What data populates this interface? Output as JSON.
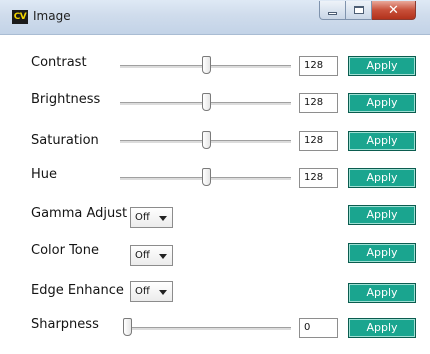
{
  "window": {
    "title": "Image",
    "icon": "CV"
  },
  "sliders": [
    {
      "label": "Contrast",
      "value": "128",
      "position": 0.5,
      "apply": "Apply"
    },
    {
      "label": "Brightness",
      "value": "128",
      "position": 0.5,
      "apply": "Apply"
    },
    {
      "label": "Saturation",
      "value": "128",
      "position": 0.5,
      "apply": "Apply"
    },
    {
      "label": "Hue",
      "value": "128",
      "position": 0.5,
      "apply": "Apply"
    }
  ],
  "dropdowns": [
    {
      "label": "Gamma Adjust",
      "selected": "Off",
      "apply": "Apply"
    },
    {
      "label": "Color Tone",
      "selected": "Off",
      "apply": "Apply"
    },
    {
      "label": "Edge Enhance",
      "selected": "Off",
      "apply": "Apply"
    }
  ],
  "sharpness": {
    "label": "Sharpness",
    "value": "0",
    "position": 0.0,
    "apply": "Apply"
  },
  "colors": {
    "apply_button": "#1aa58f",
    "titlebar": "#cfdcec",
    "close_button": "#c8503a"
  }
}
